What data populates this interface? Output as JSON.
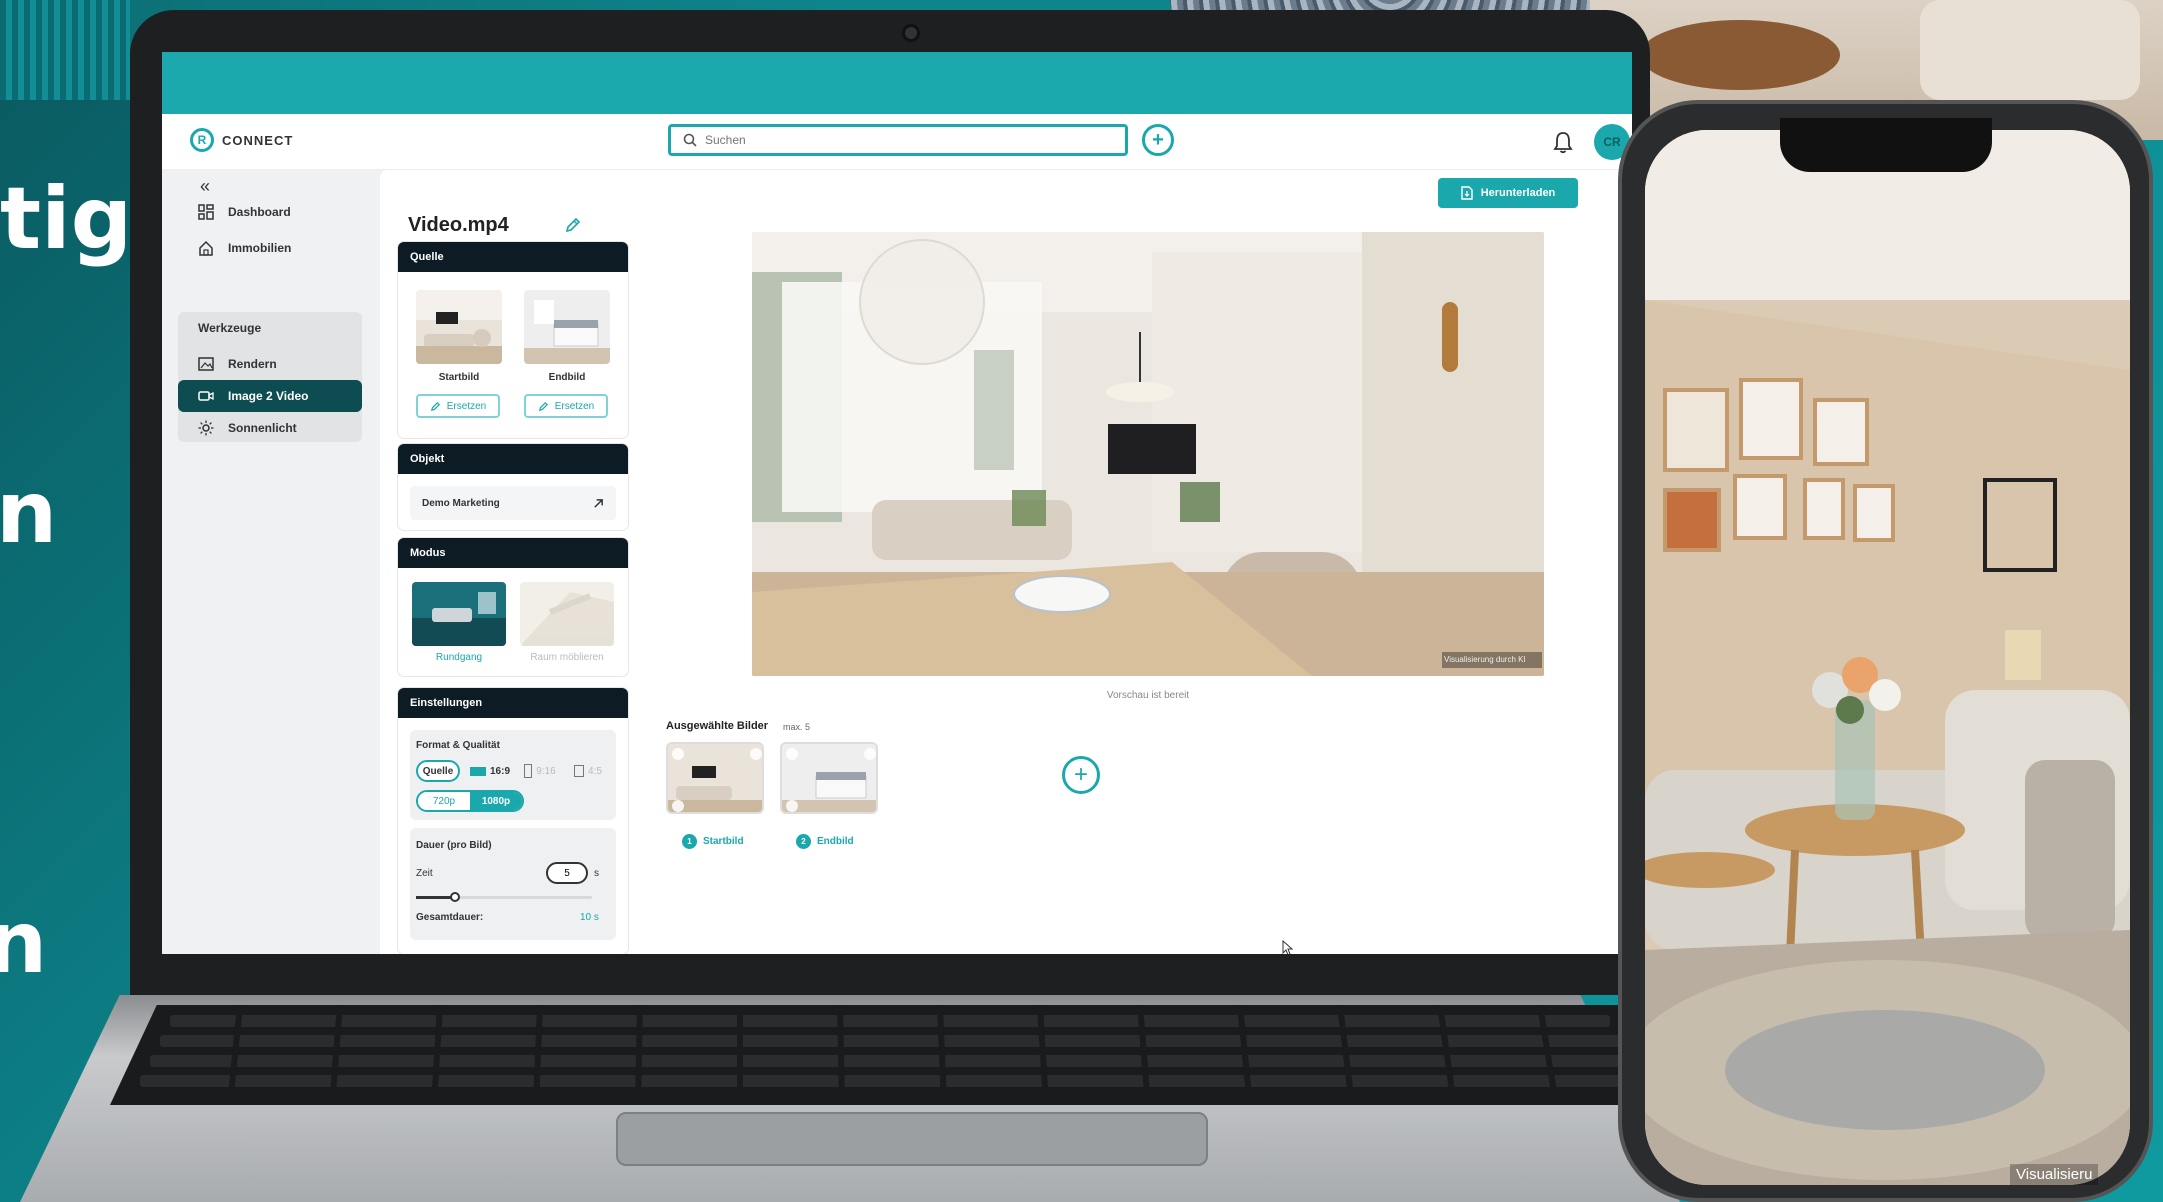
{
  "headline_fragments": [
    "tig",
    "n",
    "n"
  ],
  "app": {
    "logo_text": "CONNECT",
    "search_placeholder": "Suchen",
    "avatar_initials": "CR",
    "download_label": "Herunterladen"
  },
  "sidebar": {
    "items": [
      {
        "label": "Dashboard"
      },
      {
        "label": "Immobilien"
      },
      {
        "label": "Werkzeuge"
      },
      {
        "label": "Rendern"
      },
      {
        "label": "Image 2 Video"
      },
      {
        "label": "Sonnenlicht"
      }
    ],
    "active": "Image 2 Video"
  },
  "editor": {
    "file_title": "Video.mp4",
    "quelle": {
      "title": "Quelle",
      "start_label": "Startbild",
      "end_label": "Endbild",
      "replace_label": "Ersetzen"
    },
    "objekt": {
      "title": "Objekt",
      "value": "Demo Marketing"
    },
    "modus": {
      "title": "Modus",
      "options": [
        "Rundgang",
        "Raum möblieren"
      ],
      "selected": "Rundgang"
    },
    "einstellungen": {
      "title": "Einstellungen",
      "format_label": "Format & Qualität",
      "format_options": [
        "Quelle",
        "16:9",
        "9:16",
        "4:5"
      ],
      "format_selected": "Quelle",
      "quality_options": [
        "720p",
        "1080p"
      ],
      "quality_selected": "1080p",
      "duration_label": "Dauer (pro Bild)",
      "time_label": "Zeit",
      "time_value": "5",
      "time_unit": "s",
      "total_label": "Gesamtdauer:",
      "total_value": "10 s"
    }
  },
  "preview": {
    "caption": "Vorschau ist bereit",
    "watermark": "Visualisierung durch KI"
  },
  "selected_images": {
    "title": "Ausgewählte Bilder",
    "max": "max. 5",
    "items": [
      {
        "num": "1",
        "label": "Startbild"
      },
      {
        "num": "2",
        "label": "Endbild"
      }
    ]
  },
  "phone": {
    "caption": "Visualisieru"
  },
  "colors": {
    "accent": "#1aa8ad",
    "dark": "#0d1b24",
    "active_nav": "#0d4d52"
  }
}
